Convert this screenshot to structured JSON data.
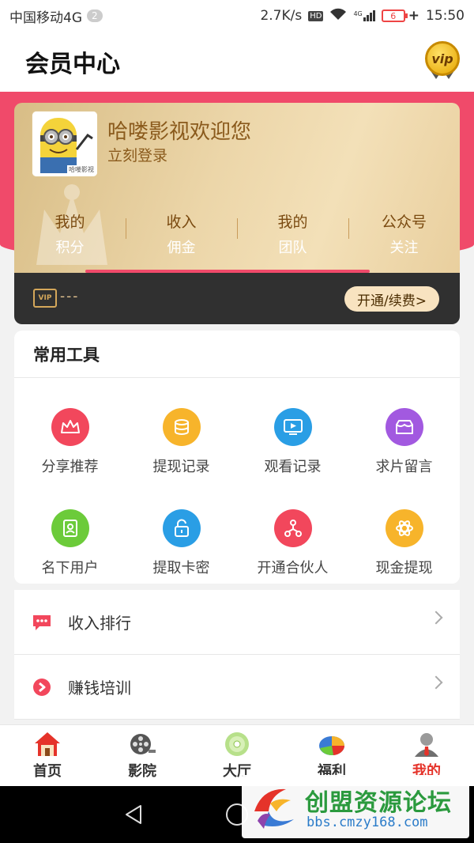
{
  "status_bar": {
    "carrier": "中国移动4G",
    "sim_badge": "2",
    "speed": "2.7K/s",
    "hd": "HD",
    "signal_label": "4G",
    "battery": "6",
    "charging": "+",
    "time": "15:50"
  },
  "header": {
    "title": "会员中心",
    "vip_badge": "vip"
  },
  "member_card": {
    "welcome": "哈喽影视欢迎您",
    "login_link": "立刻登录",
    "avatar_text": "哈喽影视",
    "stats": [
      {
        "line1": "我的",
        "line2": "积分"
      },
      {
        "line1": "收入",
        "line2": "佣金"
      },
      {
        "line1": "我的",
        "line2": "团队"
      },
      {
        "line1": "公众号",
        "line2": "关注"
      }
    ]
  },
  "vip_bar": {
    "icon_text": "VIP",
    "status": "---",
    "renew_button": "开通/续费>"
  },
  "tools": {
    "title": "常用工具",
    "items": [
      {
        "label": "分享推荐",
        "icon": "crown-icon",
        "color": "#f2475c"
      },
      {
        "label": "提现记录",
        "icon": "coins-icon",
        "color": "#f7b42b"
      },
      {
        "label": "观看记录",
        "icon": "play-screen-icon",
        "color": "#2a9ee5"
      },
      {
        "label": "求片留言",
        "icon": "message-box-icon",
        "color": "#a259e0"
      },
      {
        "label": "名下用户",
        "icon": "contacts-icon",
        "color": "#6ccb3a"
      },
      {
        "label": "提取卡密",
        "icon": "unlock-icon",
        "color": "#2a9ee5"
      },
      {
        "label": "开通合伙人",
        "icon": "network-icon",
        "color": "#f2475c"
      },
      {
        "label": "现金提现",
        "icon": "atom-icon",
        "color": "#f7b42b"
      }
    ]
  },
  "list": [
    {
      "label": "收入排行",
      "icon": "chat-dots-icon",
      "color": "#f2475c"
    },
    {
      "label": "赚钱培训",
      "icon": "play-circle-icon",
      "color": "#f2475c"
    }
  ],
  "tab_bar": {
    "items": [
      {
        "label": "首页",
        "icon": "house-icon"
      },
      {
        "label": "影院",
        "icon": "film-reel-icon"
      },
      {
        "label": "大厅",
        "icon": "disc-icon"
      },
      {
        "label": "福利",
        "icon": "pie-chart-icon"
      },
      {
        "label": "我的",
        "icon": "user-icon"
      }
    ],
    "active_color": "#e5332a"
  },
  "watermark": {
    "brand": "创盟资源论坛",
    "url": "bbs.cmzy168.com"
  }
}
